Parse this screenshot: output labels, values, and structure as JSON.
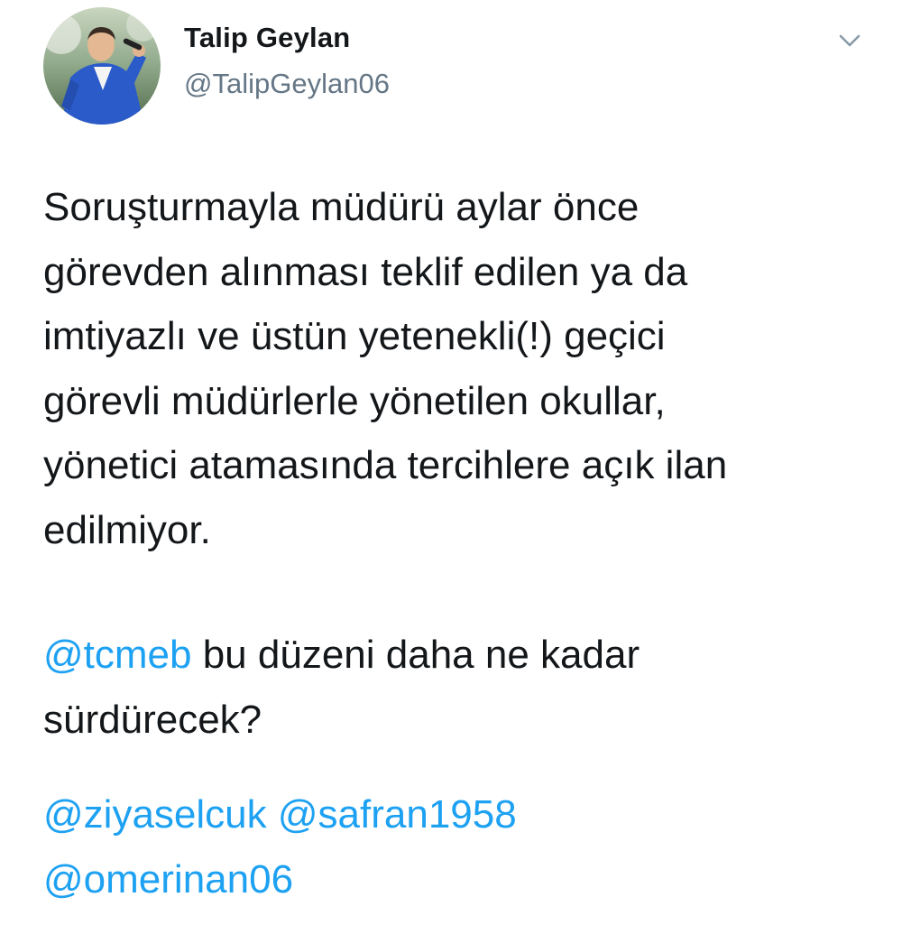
{
  "author": {
    "display_name": "Talip Geylan",
    "handle": "@TalipGeylan06",
    "avatar_icon": "profile-photo"
  },
  "menu": {
    "icon": "chevron-down-icon"
  },
  "tweet": {
    "paragraph1_lines": [
      "Soruşturmayla müdürü aylar önce",
      "görevden alınması teklif edilen ya da",
      "imtiyazlı ve üstün yetenekli(!) geçici",
      "görevli müdürlerle yönetilen okullar,",
      "yönetici atamasında tercihlere açık ilan",
      "edilmiyor."
    ],
    "paragraph2": {
      "mention": "@tcmeb",
      "line1_rest": " bu düzeni daha ne kadar",
      "line2": "sürdürecek?"
    },
    "paragraph3": {
      "mentions": [
        "@ziyaselcuk",
        "@safran1958",
        "@omerinan06"
      ]
    }
  },
  "colors": {
    "link": "#1da1f2",
    "text": "#14171a",
    "secondary": "#657786"
  }
}
